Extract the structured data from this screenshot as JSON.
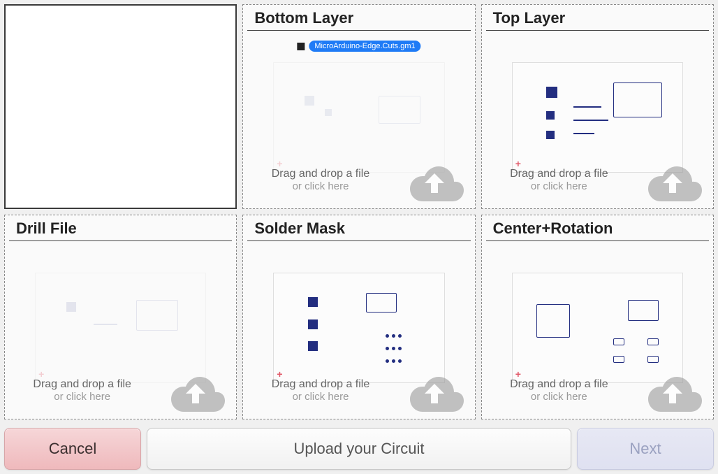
{
  "panels": {
    "preview": {},
    "bottom_layer": {
      "title": "Bottom Layer",
      "file_label": "MicroArduino-Edge.Cuts.gm1",
      "drop_l1": "Drag and drop a file",
      "drop_l2": "or click here"
    },
    "top_layer": {
      "title": "Top Layer",
      "drop_l1": "Drag and drop a file",
      "drop_l2": "or click here"
    },
    "drill_file": {
      "title": "Drill File",
      "drop_l1": "Drag and drop a file",
      "drop_l2": "or click here"
    },
    "solder_mask": {
      "title": "Solder Mask",
      "drop_l1": "Drag and drop a file",
      "drop_l2": "or click here"
    },
    "center_rotation": {
      "title": "Center+Rotation",
      "drop_l1": "Drag and drop a file",
      "drop_l2": "or click here"
    }
  },
  "footer": {
    "cancel": "Cancel",
    "upload": "Upload your Circuit",
    "next": "Next"
  }
}
